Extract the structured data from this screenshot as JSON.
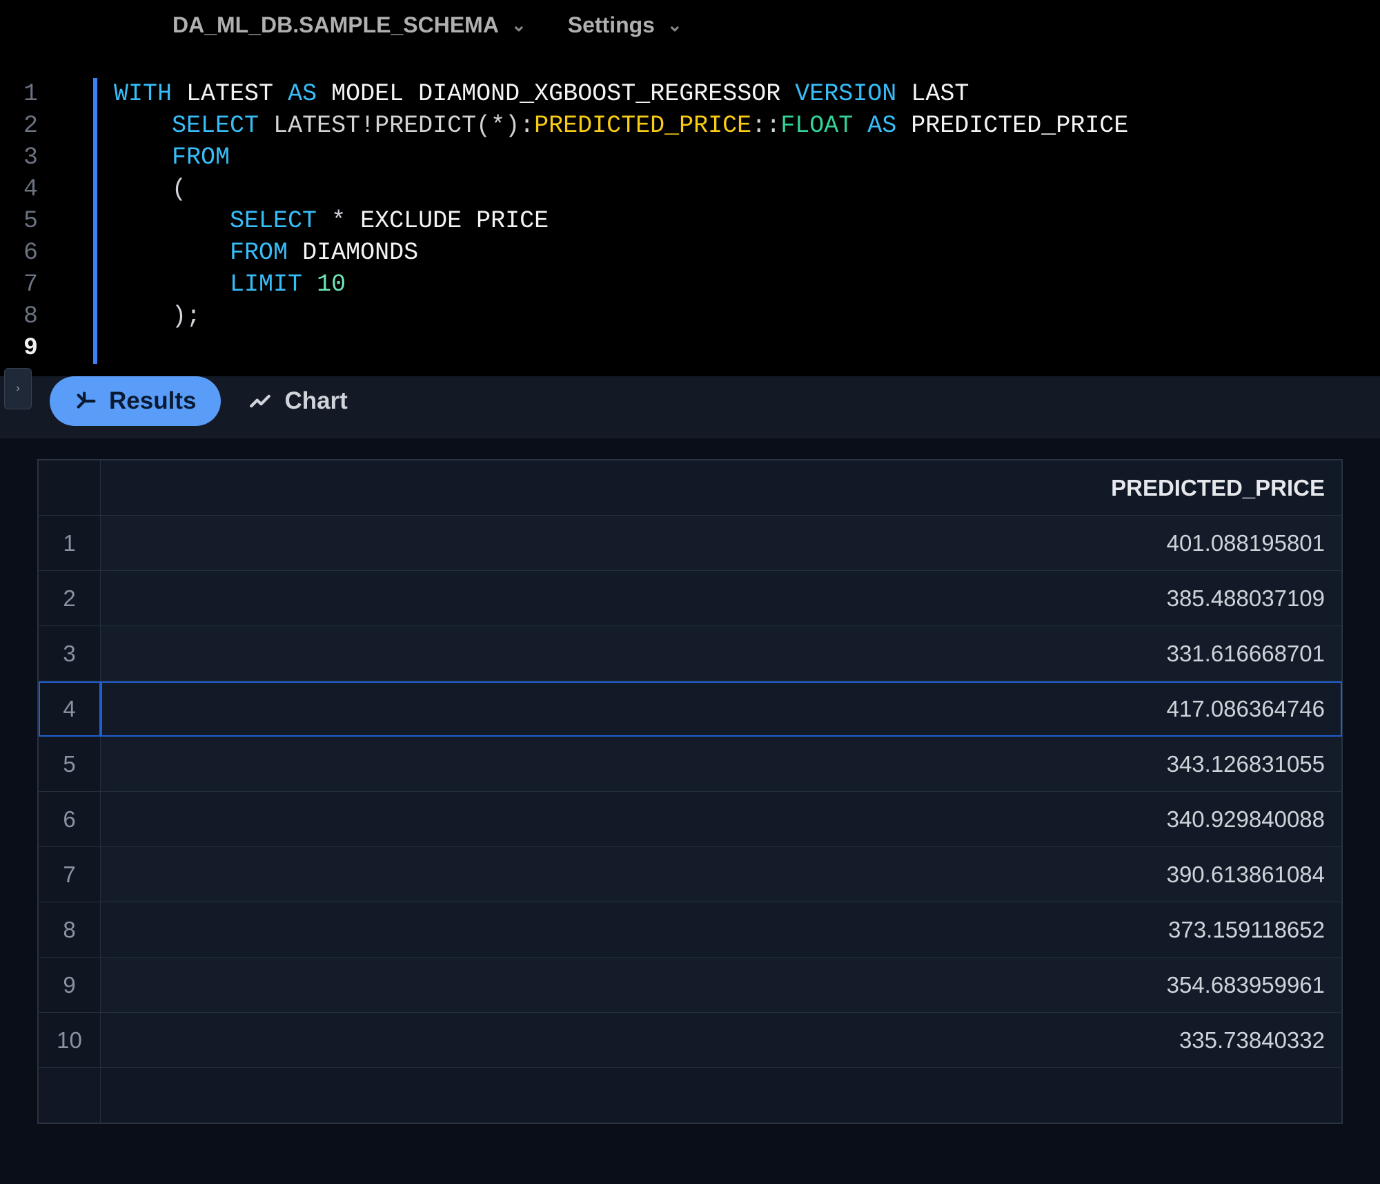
{
  "topbar": {
    "context_label": "DA_ML_DB.SAMPLE_SCHEMA",
    "settings_label": "Settings"
  },
  "editor": {
    "line_numbers": [
      "1",
      "2",
      "3",
      "4",
      "5",
      "6",
      "7",
      "8",
      "9"
    ],
    "current_line_index": 8,
    "code": {
      "l1": {
        "kw_with": "WITH",
        "ident_latest": "LATEST",
        "kw_as": "AS",
        "ident_model": "MODEL",
        "ident_regressor": "DIAMOND_XGBOOST_REGRESSOR",
        "kw_version": "VERSION",
        "ident_last": "LAST"
      },
      "l2": {
        "kw_select": "SELECT",
        "expr_prefix": "LATEST!PREDICT(*):",
        "col": "PREDICTED_PRICE",
        "cast": "::",
        "type": "FLOAT",
        "kw_as": "AS",
        "alias": "PREDICTED_PRICE"
      },
      "l3": {
        "kw_from": "FROM"
      },
      "l4": {
        "paren_open": "("
      },
      "l5": {
        "kw_select": "SELECT",
        "star": "*",
        "ident_exclude": "EXCLUDE",
        "ident_price": "PRICE"
      },
      "l6": {
        "kw_from": "FROM",
        "ident_diamonds": "DIAMONDS"
      },
      "l7": {
        "kw_limit": "LIMIT",
        "num_ten": "10"
      },
      "l8": {
        "paren_close_semi": ");"
      }
    }
  },
  "result_tabs": {
    "results_label": "Results",
    "chart_label": "Chart"
  },
  "results": {
    "column_header": "PREDICTED_PRICE",
    "selected_row": 4,
    "rows": [
      {
        "n": "1",
        "value": "401.088195801"
      },
      {
        "n": "2",
        "value": "385.488037109"
      },
      {
        "n": "3",
        "value": "331.616668701"
      },
      {
        "n": "4",
        "value": "417.086364746"
      },
      {
        "n": "5",
        "value": "343.126831055"
      },
      {
        "n": "6",
        "value": "340.929840088"
      },
      {
        "n": "7",
        "value": "390.613861084"
      },
      {
        "n": "8",
        "value": "373.159118652"
      },
      {
        "n": "9",
        "value": "354.683959961"
      },
      {
        "n": "10",
        "value": "335.73840332"
      }
    ]
  },
  "icons": {
    "chevron_down": "⌄",
    "expand_right": "›"
  }
}
